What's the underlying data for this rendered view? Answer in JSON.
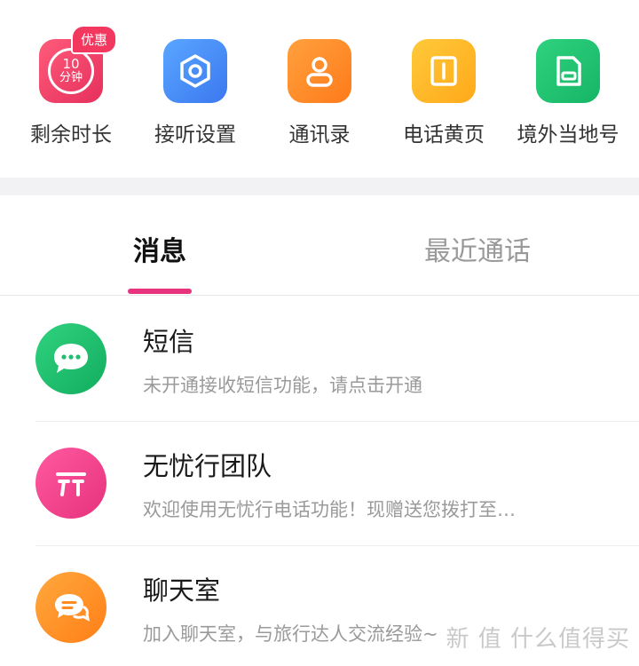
{
  "quick_actions": {
    "remaining": {
      "label": "剩余时长",
      "minutes": "10",
      "unit": "分钟",
      "badge": "优惠"
    },
    "settings": {
      "label": "接听设置"
    },
    "contacts": {
      "label": "通讯录"
    },
    "yellow_pages": {
      "label": "电话黄页"
    },
    "abroad_number": {
      "label": "境外当地号"
    }
  },
  "tabs": {
    "messages": "消息",
    "recent_calls": "最近通话"
  },
  "messages": [
    {
      "title": "短信",
      "preview": "未开通接收短信功能，请点击开通",
      "icon": "chat-bubble-icon",
      "color": "#1fbf6e"
    },
    {
      "title": "无忧行团队",
      "preview": "欢迎使用无忧行电话功能！现赠送您拨打至…",
      "icon": "wuyouxing-logo-icon",
      "color": "#ee3f88"
    },
    {
      "title": "聊天室",
      "preview": "加入聊天室，与旅行达人交流经验~",
      "icon": "chat-room-icon",
      "color": "#ff8c22"
    }
  ],
  "watermark": "新 值 什么值得买"
}
